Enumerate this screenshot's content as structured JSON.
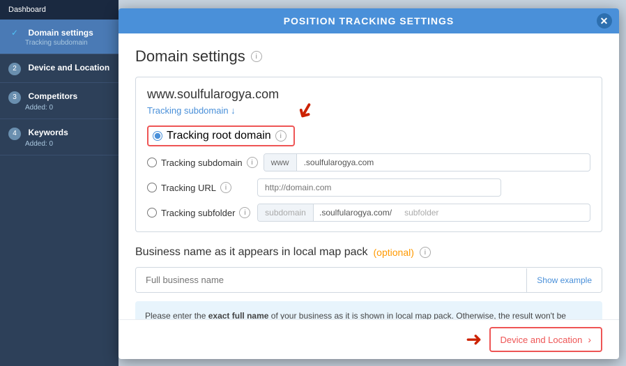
{
  "modal": {
    "header": "POSITION TRACKING SETTINGS",
    "close_icon": "✕",
    "title": "Domain settings",
    "subtitle_link": "Tracking subdomain ↓",
    "domain_url": "www.soulfularogya.com",
    "tracking_options": [
      {
        "id": "root",
        "label": "Tracking root domain",
        "checked": true,
        "highlighted": true
      },
      {
        "id": "subdomain",
        "label": "Tracking subdomain"
      },
      {
        "id": "url",
        "label": "Tracking URL"
      },
      {
        "id": "subfolder",
        "label": "Tracking subfolder"
      }
    ],
    "subdomain_prefix": "www",
    "subdomain_suffix": ".soulfularogya.com",
    "url_placeholder": "http://domain.com",
    "subfolder_prefix": "subdomain",
    "subfolder_domain": ".soulfularogya.com/",
    "subfolder_name": "subfolder",
    "business_section_title": "Business name as it appears in local map pack",
    "optional_label": "(optional)",
    "business_placeholder": "Full business name",
    "show_example": "Show example",
    "info_text_1": "Please enter the ",
    "info_text_bold": "exact full name",
    "info_text_2": " of your business as it is shown in local map pack. Otherwise, the result won't be matched",
    "next_button": "Device and Location",
    "next_icon": "›"
  },
  "sidebar": {
    "items": [
      {
        "number": "✓",
        "title": "Domain settings",
        "sub": "Tracking subdomain",
        "active": true,
        "check": true
      },
      {
        "number": "2",
        "title": "Device and Location",
        "sub": "",
        "active": false
      },
      {
        "number": "3",
        "title": "Competitors",
        "sub": "Added: 0",
        "active": false
      },
      {
        "number": "4",
        "title": "Keywords",
        "sub": "Added: 0",
        "active": false
      }
    ]
  },
  "colors": {
    "accent_blue": "#4a90d9",
    "accent_red": "#e55",
    "highlight_red": "#cc2200"
  }
}
